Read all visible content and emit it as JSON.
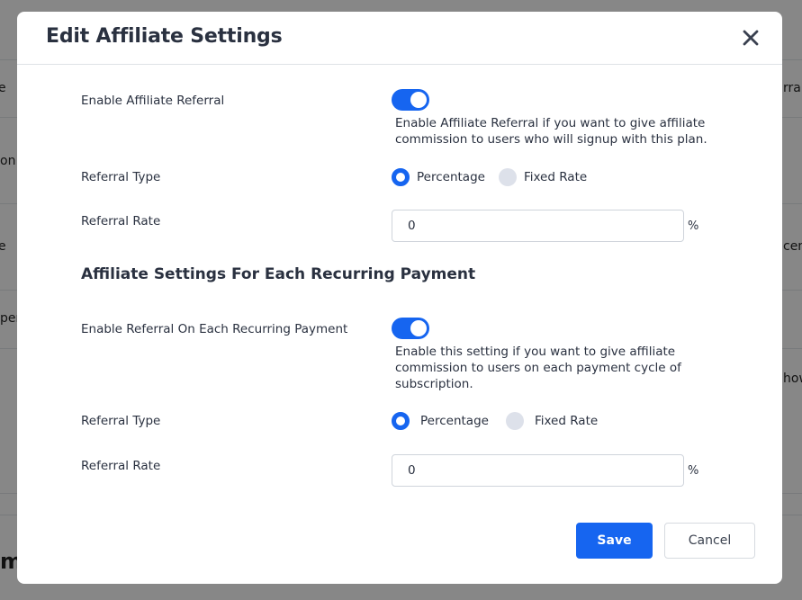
{
  "background": {
    "fragments": [
      "e",
      "on",
      "e",
      "pers",
      "rral",
      "cent",
      "how",
      "m"
    ]
  },
  "modal": {
    "title": "Edit Affiliate Settings",
    "close_icon": "close-icon",
    "enable_referral": {
      "label": "Enable Affiliate Referral",
      "enabled": true,
      "help": "Enable Affiliate Referral if you want to give affiliate commission to users who will signup with this plan."
    },
    "referral_type": {
      "label": "Referral Type",
      "options": [
        "Percentage",
        "Fixed Rate"
      ],
      "selected": "Percentage"
    },
    "referral_rate": {
      "label": "Referral Rate",
      "value": "0",
      "unit": "%"
    },
    "recurring_section_title": "Affiliate Settings For Each Recurring Payment",
    "enable_recurring": {
      "label": "Enable Referral On Each Recurring Payment",
      "enabled": true,
      "help": "Enable this setting if you want to give affiliate commission to users on each payment cycle of subscription."
    },
    "recurring_type": {
      "label": "Referral Type",
      "options": [
        "Percentage",
        "Fixed Rate"
      ],
      "selected": "Percentage"
    },
    "recurring_rate": {
      "label": "Referral Rate",
      "value": "0",
      "unit": "%"
    },
    "save_label": "Save",
    "cancel_label": "Cancel"
  },
  "colors": {
    "accent": "#1665f0",
    "text": "#2a3140",
    "overlay": "rgba(0,0,0,0.47)"
  }
}
